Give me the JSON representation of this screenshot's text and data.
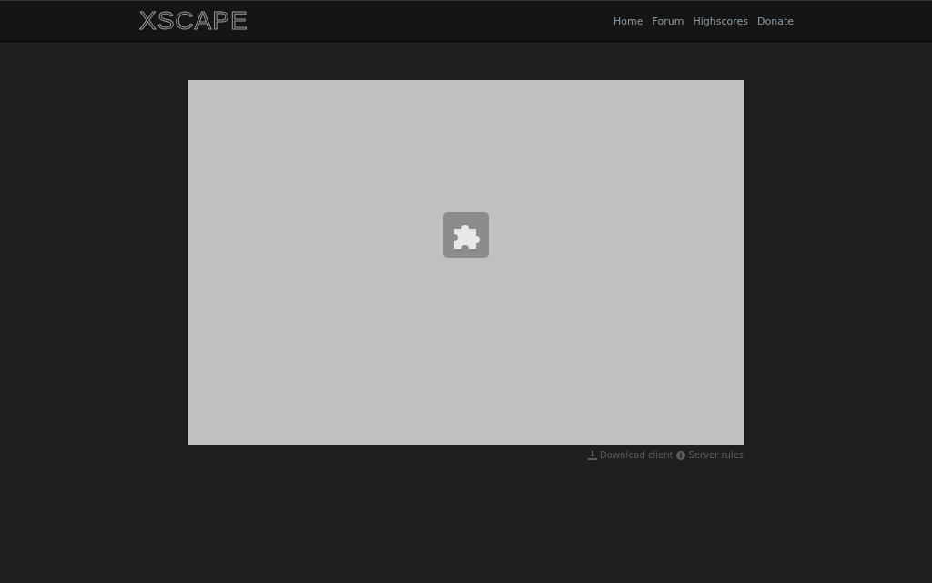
{
  "header": {
    "logo": "XSCAPE",
    "nav": [
      {
        "label": "Home"
      },
      {
        "label": "Forum"
      },
      {
        "label": "Highscores"
      },
      {
        "label": "Donate"
      }
    ]
  },
  "footer_links": [
    {
      "kind": "download",
      "label": "Download client"
    },
    {
      "kind": "info",
      "label": "Server rules"
    }
  ]
}
